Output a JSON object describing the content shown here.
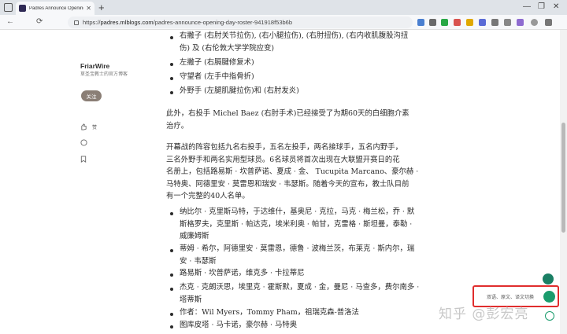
{
  "browser": {
    "tab_title": "Padres Announce Opening Day",
    "tab_close": "✕",
    "new_tab": "+",
    "url_scheme": "https://",
    "url_host": "padres.mlblogs.com",
    "url_path": "/padres-announce-opening-day-roster-941918f53b6b",
    "window_controls": [
      "—",
      "❐",
      "✕"
    ],
    "nav_back": "←",
    "nav_refresh": "⟳"
  },
  "sidebar": {
    "author": "FriarWire",
    "description": "草圣宝教士的官方博客",
    "follow": "关注",
    "like": "赞",
    "comment": "",
    "bookmark": ""
  },
  "article": {
    "top_bullets": [
      [
        "右撇子 (右肘关节拉伤), (右小腿拉伤), (右肘扭伤), (右内收肌腹股沟扭",
        "伤) 及 (右伦敦大学学院应变)"
      ],
      [
        "左撇子 (右膈腱修复术)"
      ],
      [
        "守望者 (左手中指骨折)"
      ],
      [
        "外野手 (左腿肌腱拉伤)和 (右肘发炎)"
      ]
    ],
    "para1": [
      "此外，右投手 Michel Baez (右肘手术)已经接受了为期60天的白细胞介素",
      "治疗。"
    ],
    "para2": [
      "开幕战的阵容包括九名右投手，五名左投手，两名接球手，五名内野手，",
      "三名外野手和两名实用型球员。6名球员将首次出现在大联盟开赛日的花",
      "名册上，包括路易斯 · 坎普萨诺、夏成 · 金、 Tucupita Marcano、豪尔赫 ·",
      "马特奥、阿德里安 · 莫雷恩和瑞安 · 韦瑟斯。随着今天的宣布，教士队目前",
      "有一个完整的40人名单。"
    ],
    "bottom_bullets": [
      [
        "纳比尔 · 克里斯马特，于达维什，基奥尼 · 克拉，马克 · 梅兰松，乔 · 默",
        "斯格罗夫，克里斯 · 帕达克，埃米利奥 · 帕甘，克雷格 · 斯坦曼，泰勒 ·",
        "威廉姆斯"
      ],
      [
        "蒂姆 · 希尔，阿德里安 · 莫雷恩，德鲁 · 波梅兰茨，布莱克 · 斯内尔，瑞",
        "安 · 韦瑟斯"
      ],
      [
        "路易斯 · 坎普萨诺，维克多 · 卡拉蒂尼"
      ],
      [
        "杰克 · 克朗沃思，埃里克 · 霍斯默，夏成 · 金，曼尼 · 马查多，费尔南多 ·",
        "塔蒂斯"
      ],
      [
        "作者：Wil Myers，Tommy Pham，祖瑞克森-普洛法"
      ],
      [
        "图库皮塔 · 马卡诺，豪尔赫 · 马特奥"
      ]
    ]
  },
  "widgets": {
    "translate_text": "双语、原文、译文切换",
    "watermark": "知乎 @彭宏亮"
  },
  "colors": {
    "accent_green": "#1a9c6d",
    "highlight_red": "#e02d2d",
    "follow_button": "#8a7e75"
  }
}
